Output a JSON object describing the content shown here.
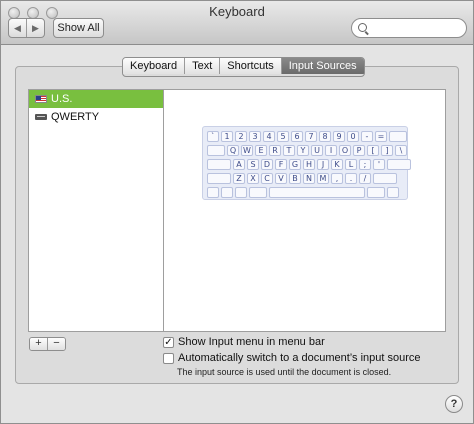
{
  "window": {
    "title": "Keyboard"
  },
  "toolbar": {
    "back_glyph": "◀",
    "forward_glyph": "▶",
    "show_all_label": "Show All",
    "search_placeholder": ""
  },
  "tabs": [
    {
      "label": "Keyboard",
      "selected": false
    },
    {
      "label": "Text",
      "selected": false
    },
    {
      "label": "Shortcuts",
      "selected": false
    },
    {
      "label": "Input Sources",
      "selected": true
    }
  ],
  "sources": [
    {
      "label": "U.S.",
      "icon": "us-flag-icon",
      "selected": true
    },
    {
      "label": "QWERTY",
      "icon": "keyboard-icon",
      "selected": false
    }
  ],
  "keyboard_preview": {
    "rows": [
      [
        "`",
        "1",
        "2",
        "3",
        "4",
        "5",
        "6",
        "7",
        "8",
        "9",
        "0",
        "-",
        "="
      ],
      [
        "Q",
        "W",
        "E",
        "R",
        "T",
        "Y",
        "U",
        "I",
        "O",
        "P",
        "[",
        "]",
        "\\"
      ],
      [
        "A",
        "S",
        "D",
        "F",
        "G",
        "H",
        "J",
        "K",
        "L",
        ";",
        "'"
      ],
      [
        "Z",
        "X",
        "C",
        "V",
        "B",
        "N",
        "M",
        ",",
        ".",
        "/"
      ]
    ]
  },
  "list_buttons": {
    "add": "+",
    "remove": "−"
  },
  "options": {
    "show_menu_label": "Show Input menu in menu bar",
    "show_menu_checked": true,
    "auto_switch_label": "Automatically switch to a document’s input source",
    "auto_switch_checked": false,
    "hint": "The input source is used until the document is closed."
  },
  "help_label": "?",
  "colors": {
    "selection": "#79bf3f",
    "key_text": "#3f4d8a"
  }
}
